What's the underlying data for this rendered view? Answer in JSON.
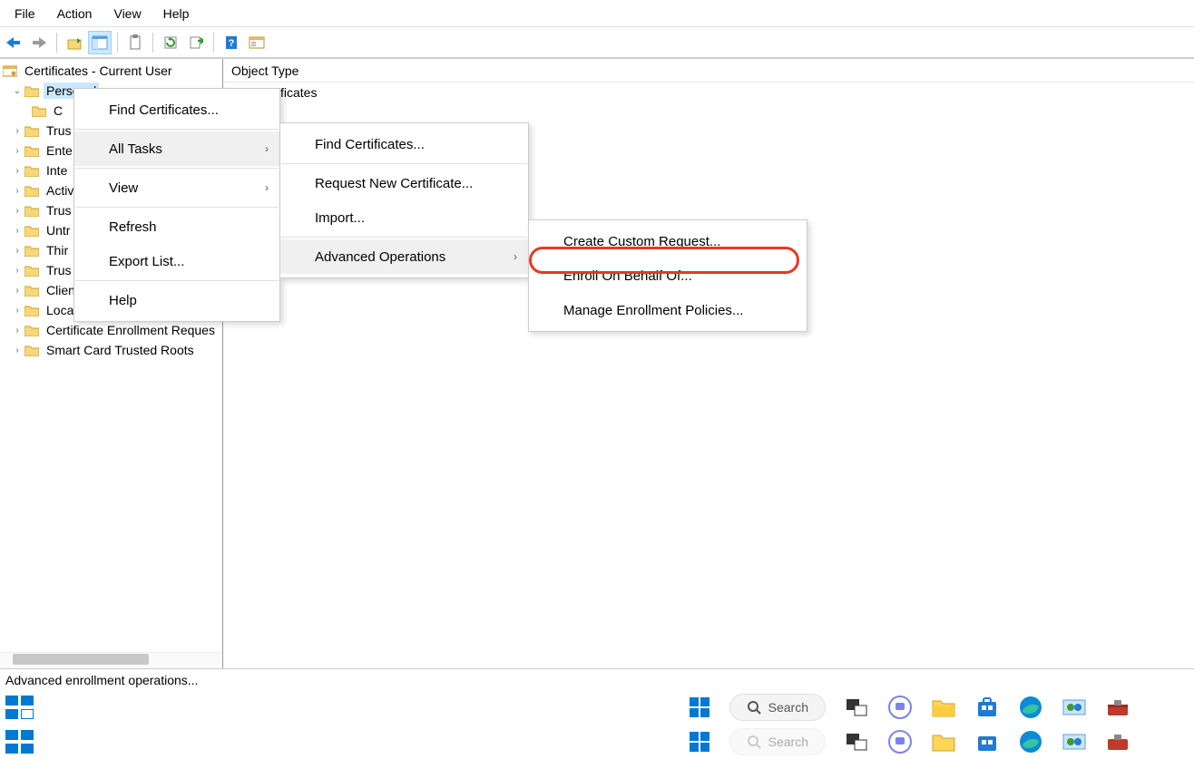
{
  "menubar": [
    "File",
    "Action",
    "View",
    "Help"
  ],
  "tree": {
    "root": "Certificates - Current User",
    "selected": "Personal",
    "child_partial": "C",
    "items": [
      "Trus",
      "Ente",
      "Inte",
      "Activ",
      "Trus",
      "Untr",
      "Thir",
      "Trus",
      "Client Authentication Issuers",
      "Local NonRemovable Certifica",
      "Certificate Enrollment Reques",
      "Smart Card Trusted Roots"
    ]
  },
  "content": {
    "header": "Object Type",
    "row_partial": "ficates"
  },
  "ctx1": {
    "find": "Find Certificates...",
    "alltasks": "All Tasks",
    "view": "View",
    "refresh": "Refresh",
    "export": "Export List...",
    "help": "Help"
  },
  "ctx2": {
    "find": "Find Certificates...",
    "request": "Request New Certificate...",
    "import": "Import...",
    "advanced": "Advanced Operations"
  },
  "ctx3": {
    "custom": "Create Custom Request...",
    "enroll": "Enroll On Behalf Of...",
    "manage": "Manage Enrollment Policies..."
  },
  "status": "Advanced enrollment operations...",
  "taskbar": {
    "search": "Search"
  }
}
